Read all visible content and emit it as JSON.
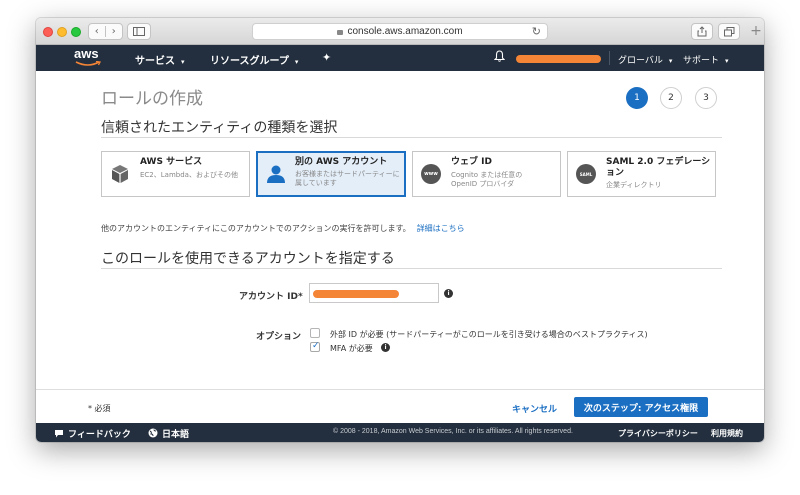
{
  "browser": {
    "url": "console.aws.amazon.com",
    "back_glyph": "‹",
    "forward_glyph": "›",
    "reload_glyph": "↻",
    "plus_glyph": "+"
  },
  "awsnav": {
    "logo_text": "aws",
    "services": "サービス",
    "resource_groups": "リソースグループ",
    "region": "グローバル",
    "support": "サポート",
    "caret": "▾",
    "pin_glyph": "✦",
    "bell_glyph": "🔔",
    "accent_color": "#f58536"
  },
  "wizard": {
    "title": "ロールの作成",
    "steps": [
      "1",
      "2",
      "3"
    ],
    "active_step": "1"
  },
  "entity_section": {
    "heading": "信頼されたエンティティの種類を選択",
    "cards": [
      {
        "title": "AWS サービス",
        "desc": "EC2、Lambda、およびその他",
        "icon": "cube-icon"
      },
      {
        "title": "別の AWS アカウント",
        "desc": "お客様またはサードパーティーに属しています",
        "icon": "user-icon",
        "selected": true
      },
      {
        "title": "ウェブ ID",
        "desc": "Cognito または任意の OpenID プロバイダ",
        "icon": "www-icon",
        "icon_text": "www"
      },
      {
        "title": "SAML 2.0 フェデレーション",
        "desc": "企業ディレクトリ",
        "icon": "saml-icon",
        "icon_text": "SAML"
      }
    ],
    "help_text": "他のアカウントのエンティティにこのアカウントでのアクションの実行を許可します。",
    "help_link": "詳細はこちら"
  },
  "account_section": {
    "heading": "このロールを使用できるアカウントを指定する",
    "account_id_label": "アカウント ID*",
    "options_label": "オプション",
    "option_external_id": "外部 ID が必要 (サードパーティーがこのロールを引き受ける場合のベストプラクティス)",
    "option_mfa": "MFA が必要",
    "external_id_checked": false,
    "mfa_checked": true,
    "info_glyph": "i",
    "check_glyph": "✓"
  },
  "actions": {
    "required_note": "* 必須",
    "cancel": "キャンセル",
    "next": "次のステップ: アクセス権限"
  },
  "footer": {
    "feedback": "フィードバック",
    "language": "日本語",
    "copyright": "© 2008 - 2018, Amazon Web Services, Inc. or its affiliates. All rights reserved.",
    "privacy": "プライバシーポリシー",
    "terms": "利用規約"
  }
}
